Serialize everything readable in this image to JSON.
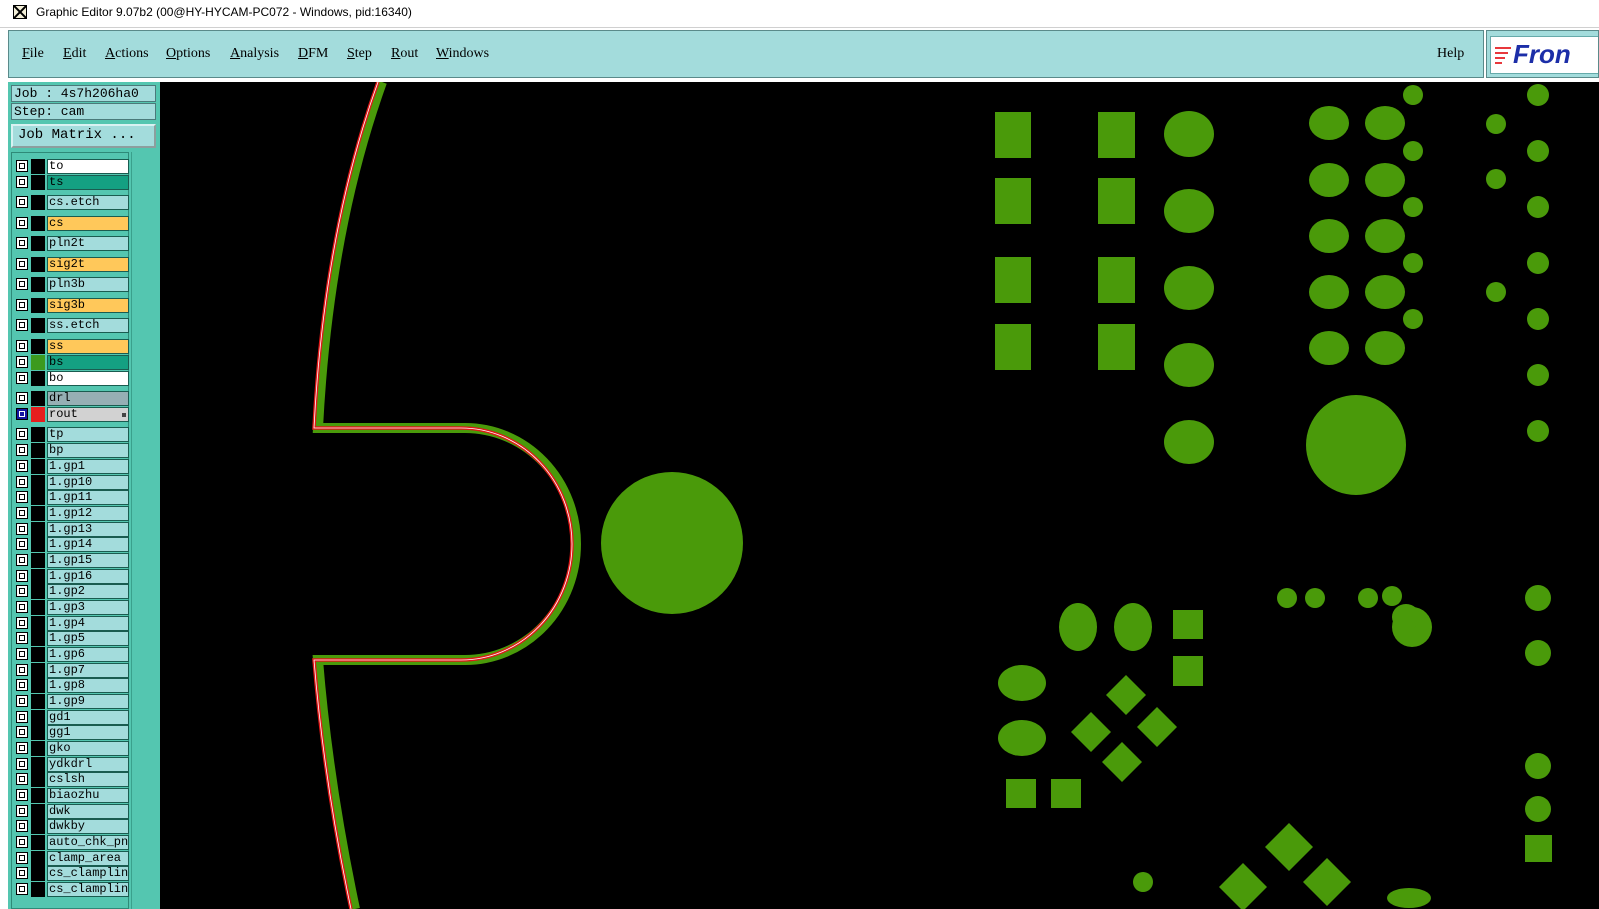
{
  "window": {
    "title": "Graphic Editor 9.07b2 (00@HY-HYCAM-PC072 - Windows, pid:16340)",
    "icon": "app-icon"
  },
  "menubar": {
    "items": [
      "File",
      "Edit",
      "Actions",
      "Options",
      "Analysis",
      "DFM",
      "Step",
      "Rout",
      "Windows"
    ],
    "help": "Help"
  },
  "logo": {
    "text": "Fron"
  },
  "job": {
    "line": "Job : 4s7h206ha0",
    "step": "Step: cam",
    "matrix_button": "Job Matrix ..."
  },
  "layers": [
    {
      "name": "to",
      "color": "#ffffff"
    },
    {
      "name": "ts",
      "color": "#14a082"
    },
    {
      "name": "cs.etch",
      "color": "#a3dcdc"
    },
    {
      "name": "cs",
      "color": "#ffc85a"
    },
    {
      "name": "pln2t",
      "color": "#a3dcdc"
    },
    {
      "name": "sig2t",
      "color": "#ffc85a"
    },
    {
      "name": "pln3b",
      "color": "#a3dcdc"
    },
    {
      "name": "sig3b",
      "color": "#ffc85a"
    },
    {
      "name": "ss.etch",
      "color": "#a3dcdc"
    },
    {
      "name": "ss",
      "color": "#ffc85a"
    },
    {
      "name": "bs",
      "color": "#14a082",
      "swatch": "#3c9a1e"
    },
    {
      "name": "bo",
      "color": "#ffffff"
    },
    {
      "name": "drl",
      "color": "#96afb4"
    },
    {
      "name": "rout",
      "color": "#d2d2d2",
      "swatch": "#e61e1e",
      "selected": true
    },
    {
      "name": "tp",
      "color": "#a3dcdc"
    },
    {
      "name": "bp",
      "color": "#a3dcdc"
    },
    {
      "name": "1.gp1",
      "color": "#a3dcdc"
    },
    {
      "name": "1.gp10",
      "color": "#a3dcdc"
    },
    {
      "name": "1.gp11",
      "color": "#a3dcdc"
    },
    {
      "name": "1.gp12",
      "color": "#a3dcdc"
    },
    {
      "name": "1.gp13",
      "color": "#a3dcdc"
    },
    {
      "name": "1.gp14",
      "color": "#a3dcdc"
    },
    {
      "name": "1.gp15",
      "color": "#a3dcdc"
    },
    {
      "name": "1.gp16",
      "color": "#a3dcdc"
    },
    {
      "name": "1.gp2",
      "color": "#a3dcdc"
    },
    {
      "name": "1.gp3",
      "color": "#a3dcdc"
    },
    {
      "name": "1.gp4",
      "color": "#a3dcdc"
    },
    {
      "name": "1.gp5",
      "color": "#a3dcdc"
    },
    {
      "name": "1.gp6",
      "color": "#a3dcdc"
    },
    {
      "name": "1.gp7",
      "color": "#a3dcdc"
    },
    {
      "name": "1.gp8",
      "color": "#a3dcdc"
    },
    {
      "name": "1.gp9",
      "color": "#a3dcdc"
    },
    {
      "name": "gd1",
      "color": "#a3dcdc"
    },
    {
      "name": "gg1",
      "color": "#a3dcdc"
    },
    {
      "name": "gko",
      "color": "#a3dcdc"
    },
    {
      "name": "ydkdrl",
      "color": "#a3dcdc"
    },
    {
      "name": "cslsh",
      "color": "#a3dcdc"
    },
    {
      "name": "biaozhu",
      "color": "#a3dcdc"
    },
    {
      "name": "dwk",
      "color": "#a3dcdc"
    },
    {
      "name": "dwkby",
      "color": "#a3dcdc"
    },
    {
      "name": "auto_chk_pnl",
      "color": "#a3dcdc"
    },
    {
      "name": "clamp_area",
      "color": "#a3dcdc"
    },
    {
      "name": "cs_clampline",
      "color": "#a3dcdc"
    },
    {
      "name": "cs_clampline",
      "color": "#a3dcdc"
    }
  ],
  "colors": {
    "canvas_bg": "#000000",
    "copper": "#4a9a0a",
    "rout": "#e01818",
    "menu_bg": "#a3dcdc",
    "panel_bg": "#54c6b0"
  }
}
